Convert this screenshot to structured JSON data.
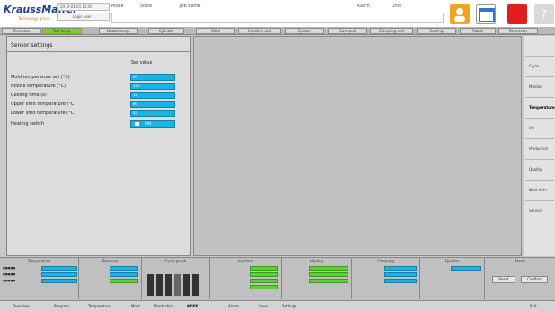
{
  "header": {
    "logo": "KraussMaffei",
    "logo_sub": "Technology group",
    "field1": "2013-01-01 12:00",
    "field2": "Login user",
    "mode_label": "Mode",
    "state_label": "State",
    "job_label": "Job name",
    "alarm_label": "Alarm",
    "unit_label": "Unit"
  },
  "tabs": [
    "Overview",
    "Tool temp.",
    "Nozzle temp.",
    "Cylinder",
    "Mold",
    "Injection unit",
    "Ejector",
    "Core pull",
    "Clamping unit",
    "Cooling",
    "Robot",
    "Parameter"
  ],
  "panel": {
    "title": "Sensor settings",
    "column_header": "Set value",
    "rows": [
      {
        "label": "Mold temperature set (°C)",
        "value": "60"
      },
      {
        "label": "Nozzle temperature (°C)",
        "value": "220"
      },
      {
        "label": "Cooling time (s)",
        "value": "12"
      },
      {
        "label": "Upper limit temperature (°C)",
        "value": "80"
      },
      {
        "label": "Lower limit temperature (°C)",
        "value": "40"
      }
    ],
    "switch_label": "Heating switch",
    "switch_value": "ON"
  },
  "right_nav": [
    {
      "label": "Cycle",
      "active": false
    },
    {
      "label": "Monitor",
      "active": false
    },
    {
      "label": "Temperature",
      "active": true
    },
    {
      "label": "I/O",
      "active": false
    },
    {
      "label": "Production",
      "active": false
    },
    {
      "label": "Quality",
      "active": false
    },
    {
      "label": "Mold data",
      "active": false
    },
    {
      "label": "Service",
      "active": false
    }
  ],
  "status": {
    "sections": [
      {
        "title": "Temperature"
      },
      {
        "title": "Pressure"
      },
      {
        "title": "Cycle graph"
      },
      {
        "title": "Injection"
      },
      {
        "title": "Holding"
      },
      {
        "title": "Clamping"
      },
      {
        "title": "Ejection"
      },
      {
        "title": "Alarm"
      }
    ],
    "btn_reset": "Reset",
    "btn_ack": "Confirm"
  },
  "bottom": [
    "Overview",
    "Program",
    "Temperature",
    "Mold",
    "Production",
    "KKKK",
    "Alarm",
    "Save",
    "Settings",
    "Exit"
  ]
}
